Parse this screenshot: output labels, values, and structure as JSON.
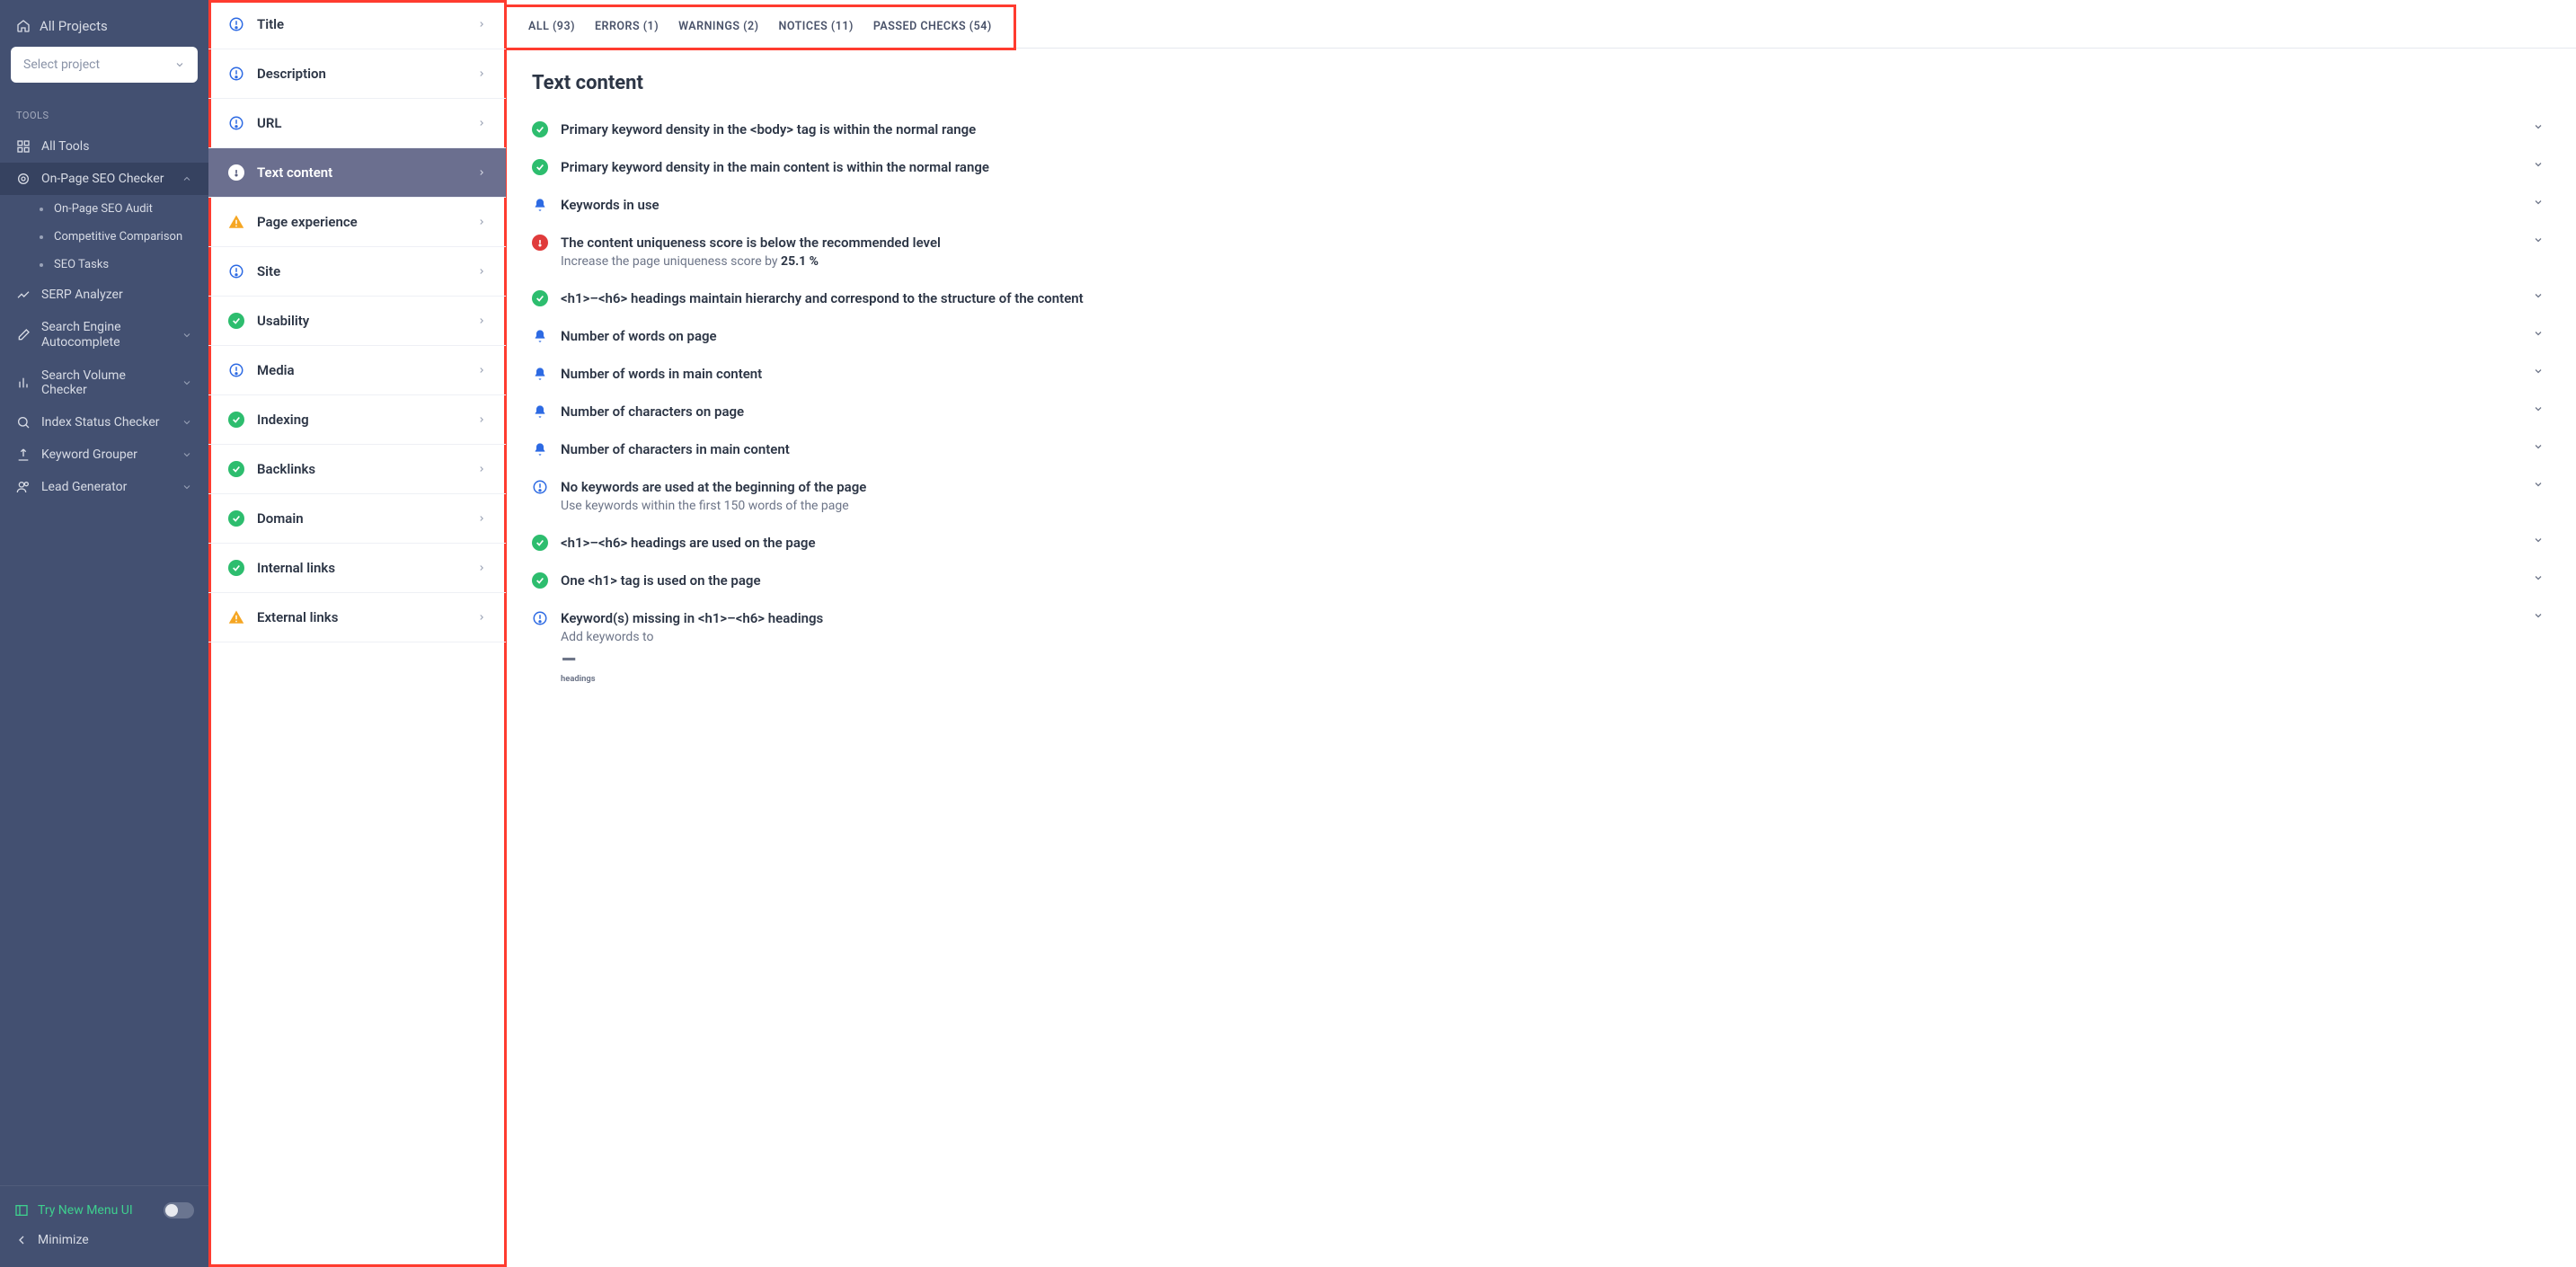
{
  "sidebar": {
    "all_projects": "All Projects",
    "select_placeholder": "Select project",
    "tools_label": "TOOLS",
    "items": [
      {
        "label": "All Tools"
      },
      {
        "label": "On-Page SEO Checker",
        "active": true
      },
      {
        "label": "SERP Analyzer"
      },
      {
        "label": "Search Engine Autocomplete"
      },
      {
        "label": "Search Volume Checker"
      },
      {
        "label": "Index Status Checker"
      },
      {
        "label": "Keyword Grouper"
      },
      {
        "label": "Lead Generator"
      }
    ],
    "sub": [
      {
        "label": "On-Page SEO Audit"
      },
      {
        "label": "Competitive Comparison"
      },
      {
        "label": "SEO Tasks"
      }
    ],
    "try_label": "Try New Menu UI",
    "minimize": "Minimize"
  },
  "categories": [
    {
      "icon": "info-blue",
      "label": "Title"
    },
    {
      "icon": "info-blue",
      "label": "Description"
    },
    {
      "icon": "info-blue",
      "label": "URL"
    },
    {
      "icon": "active-cat",
      "label": "Text content",
      "active": true
    },
    {
      "icon": "warn",
      "label": "Page experience"
    },
    {
      "icon": "info-blue",
      "label": "Site"
    },
    {
      "icon": "pass",
      "label": "Usability"
    },
    {
      "icon": "info-blue",
      "label": "Media"
    },
    {
      "icon": "pass",
      "label": "Indexing"
    },
    {
      "icon": "pass",
      "label": "Backlinks"
    },
    {
      "icon": "pass",
      "label": "Domain"
    },
    {
      "icon": "pass",
      "label": "Internal links"
    },
    {
      "icon": "warn",
      "label": "External links"
    }
  ],
  "tabs": [
    {
      "label": "ALL (93)"
    },
    {
      "label": "ERRORS (1)"
    },
    {
      "label": "WARNINGS (2)"
    },
    {
      "label": "NOTICES (11)"
    },
    {
      "label": "PASSED CHECKS (54)"
    }
  ],
  "heading": "Text content",
  "checks": [
    {
      "status": "pass",
      "title": "Primary keyword density in the <body> tag is within the normal range"
    },
    {
      "status": "pass",
      "title": "Primary keyword density in the main content is within the normal range"
    },
    {
      "status": "notice",
      "title": "Keywords in use"
    },
    {
      "status": "error",
      "title": "The content uniqueness score is below the recommended level",
      "sub_pre": "Increase the page uniqueness score by ",
      "sub_bold": "25.1 %"
    },
    {
      "status": "pass",
      "title": "<h1>–<h6> headings maintain hierarchy and correspond to the structure of the content"
    },
    {
      "status": "notice",
      "title": "Number of words on page"
    },
    {
      "status": "notice",
      "title": "Number of words in main content"
    },
    {
      "status": "notice",
      "title": "Number of characters on page"
    },
    {
      "status": "notice",
      "title": "Number of characters in main content"
    },
    {
      "status": "info",
      "title": "No keywords are used at the beginning of the page",
      "sub_pre": "Use keywords within the first 150 words of the page"
    },
    {
      "status": "pass",
      "title": "<h1>–<h6> headings are used on the page"
    },
    {
      "status": "pass",
      "title": "One <h1> tag is used on the page"
    },
    {
      "status": "info",
      "title": "Keyword(s) missing in <h1>–<h6> headings",
      "sub_pre": "Add keywords to <h1>–<h6> headings"
    }
  ]
}
